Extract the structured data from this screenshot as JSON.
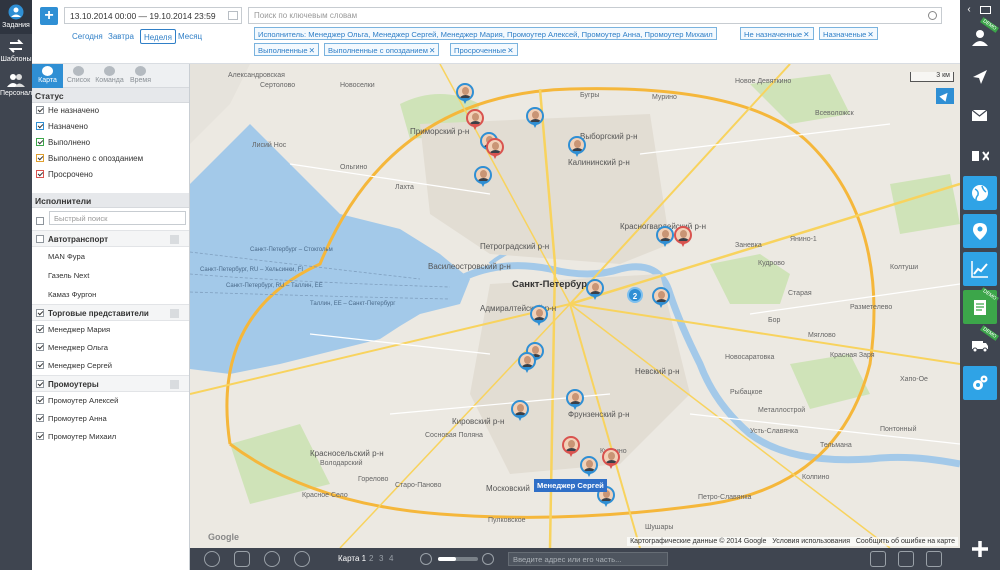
{
  "appnav": [
    {
      "label": "Задания",
      "icon": "person-circle-icon"
    },
    {
      "label": "Шаблоны",
      "icon": "swap-arrows-icon"
    },
    {
      "label": "Персонал",
      "icon": "people-icon"
    }
  ],
  "topbar": {
    "add_label": "+",
    "date_range": "13.10.2014 00:00 — 19.10.2014 23:59",
    "periods": [
      "Сегодня",
      "Завтра",
      "Неделя",
      "Месяц"
    ],
    "active_period": "Неделя",
    "search_placeholder": "Поиск по ключевым словам",
    "chips": [
      "Исполнитель: Менеджер Ольга, Менеджер Сергей, Менеджер Мария, Промоутер Алексей, Промоутер Анна, Промоутер Михаил",
      "Не назначенные",
      "Назначеные",
      "Выполненные",
      "Выполненные с опозданием",
      "Просроченные"
    ]
  },
  "panel": {
    "tabs": [
      "Карта",
      "Список",
      "Команда",
      "Время"
    ],
    "active_tab": "Карта",
    "status_title": "Статус",
    "statuses": [
      {
        "label": "Не назначено",
        "checked": true,
        "color": "#8e959c"
      },
      {
        "label": "Назначено",
        "checked": true,
        "color": "#2f8fd4"
      },
      {
        "label": "Выполнено",
        "checked": true,
        "color": "#3ca64a"
      },
      {
        "label": "Выполнено с опозданием",
        "checked": true,
        "color": "#e0a030"
      },
      {
        "label": "Просрочено",
        "checked": true,
        "color": "#d9534f"
      }
    ],
    "executors_title": "Исполнители",
    "quick_search_placeholder": "Быстрый поиск",
    "groups": [
      {
        "label": "Автотранспорт",
        "checked": false,
        "items": [
          {
            "label": "MAN Фура"
          },
          {
            "label": "Газель Next"
          },
          {
            "label": "Камаз Фургон"
          }
        ]
      },
      {
        "label": "Торговые представители",
        "checked": true,
        "items": [
          {
            "label": "Менеджер Мария"
          },
          {
            "label": "Менеджер Ольга"
          },
          {
            "label": "Менеджер Сергей"
          }
        ]
      },
      {
        "label": "Промоутеры",
        "checked": true,
        "items": [
          {
            "label": "Промоутер Алексей"
          },
          {
            "label": "Промоутер Анна"
          },
          {
            "label": "Промоутер Михаил"
          }
        ]
      }
    ]
  },
  "map": {
    "scale": "3 км",
    "districts": [
      {
        "label": "Приморский р-н"
      },
      {
        "label": "Выборгский р-н"
      },
      {
        "label": "Калининский р-н"
      },
      {
        "label": "Красногвардейский р-н"
      },
      {
        "label": "Петроградский р-н"
      },
      {
        "label": "Василеостровский р-н"
      },
      {
        "label": "Санкт-Петербург"
      },
      {
        "label": "Адмиралтейский р-н"
      },
      {
        "label": "Невский р-н"
      },
      {
        "label": "Фрунзенский р-н"
      },
      {
        "label": "Кировский р-н"
      },
      {
        "label": "Красносельский р-н"
      },
      {
        "label": "Московский"
      }
    ],
    "towns": [
      {
        "label": "Александровская"
      },
      {
        "label": "Новоселки"
      },
      {
        "label": "Мурино"
      },
      {
        "label": "Бугры"
      },
      {
        "label": "Новое Девяткино"
      },
      {
        "label": "Всеволожск"
      },
      {
        "label": "Сертолово"
      },
      {
        "label": "Лахта"
      },
      {
        "label": "Лисий Нос"
      },
      {
        "label": "Ольгино"
      },
      {
        "label": "Кудрово"
      },
      {
        "label": "Янино-1"
      },
      {
        "label": "Колтуши"
      },
      {
        "label": "Заневка"
      },
      {
        "label": "Старая"
      },
      {
        "label": "Разметелево"
      },
      {
        "label": "Мяглово"
      },
      {
        "label": "Бор"
      },
      {
        "label": "Красная Заря"
      },
      {
        "label": "Хапо-Ое"
      },
      {
        "label": "Новосаратовка"
      },
      {
        "label": "Рыбацкое"
      },
      {
        "label": "Усть-Славянка"
      },
      {
        "label": "Петро-Славянка"
      },
      {
        "label": "Колпино"
      },
      {
        "label": "Купчино"
      },
      {
        "label": "Красное Село"
      },
      {
        "label": "Володарский"
      },
      {
        "label": "Старо-Паново"
      },
      {
        "label": "Сосновая Поляна"
      },
      {
        "label": "Горелово"
      },
      {
        "label": "Пулковское"
      },
      {
        "label": "Шушары"
      },
      {
        "label": "Металлострой"
      },
      {
        "label": "Понтонный"
      },
      {
        "label": "Тельмана"
      }
    ],
    "ferry_labels": [
      "Санкт-Петербург – Стокгольм",
      "Санкт-Петербург, RU – Хельсинки, FI",
      "Санкт-Петербург, RU – Таллин, EE",
      "Таллин, EE – Санкт-Петербург"
    ],
    "cluster_count": "2",
    "selected_pin_label": "Менеджер Сергей",
    "attribution": [
      "Картографические данные © 2014 Google",
      "Условия использования",
      "Сообщить об ошибке на карте"
    ],
    "google_logo": "Google"
  },
  "bottombar": {
    "map_tabs": [
      "Карта 1",
      "2",
      "3",
      "4"
    ],
    "active_map": "Карта 1",
    "zoom_level": 0.45,
    "address_placeholder": "Введите адрес или его часть..."
  },
  "rightbar": {
    "demo_label": "DEMO"
  }
}
